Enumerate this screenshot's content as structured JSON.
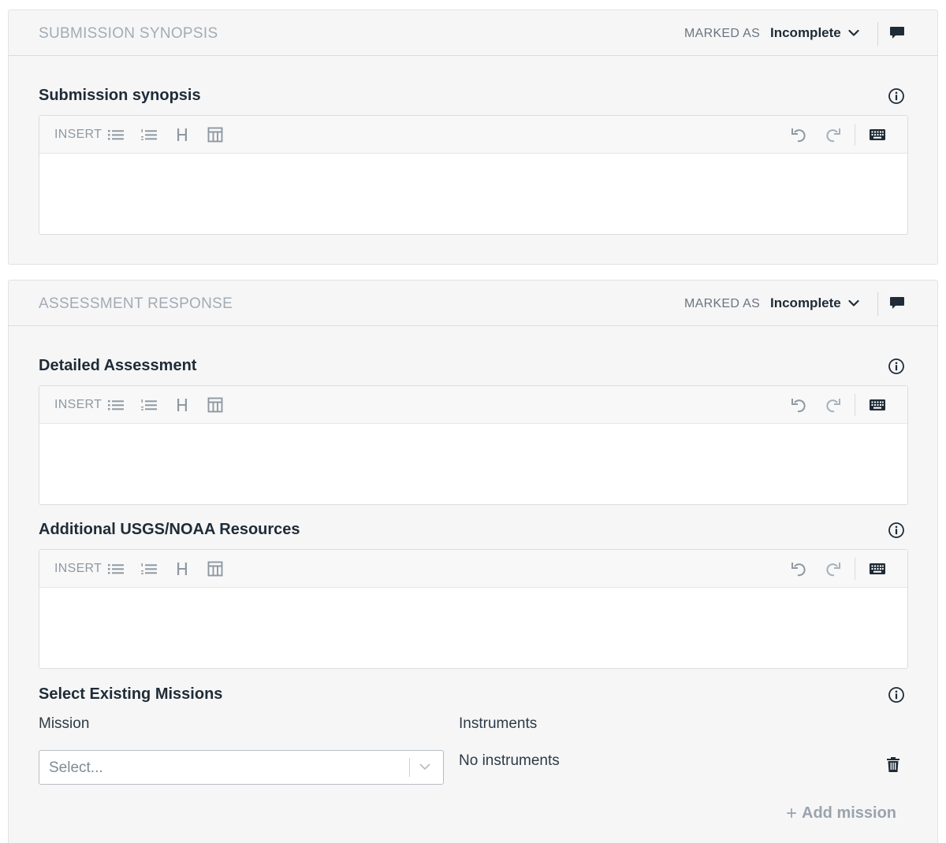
{
  "panels": [
    {
      "title": "SUBMISSION SYNOPSIS",
      "marked_as_label": "MARKED AS",
      "status": "Incomplete",
      "fields": [
        {
          "label": "Submission synopsis",
          "toolbar_insert": "INSERT"
        }
      ]
    },
    {
      "title": "ASSESSMENT RESPONSE",
      "marked_as_label": "MARKED AS",
      "status": "Incomplete",
      "fields": [
        {
          "label": "Detailed Assessment",
          "toolbar_insert": "INSERT"
        },
        {
          "label": "Additional USGS/NOAA Resources",
          "toolbar_insert": "INSERT"
        }
      ],
      "missions": {
        "label": "Select Existing Missions",
        "mission_col": "Mission",
        "instruments_col": "Instruments",
        "select_placeholder": "Select...",
        "no_instruments": "No instruments",
        "add_mission": "Add mission"
      }
    }
  ],
  "icons": {
    "toolbar": [
      "bulleted-list-icon",
      "numbered-list-icon",
      "heading-icon",
      "table-icon",
      "undo-icon",
      "redo-icon",
      "keyboard-icon"
    ],
    "header": [
      "chevron-down-icon",
      "comment-icon"
    ],
    "field": "info-icon"
  },
  "colors": {
    "panel_bg": "#f6f6f6",
    "title_muted": "#a3abb5",
    "text_dark": "#1f2b37",
    "icon_muted": "#8f98a2"
  }
}
